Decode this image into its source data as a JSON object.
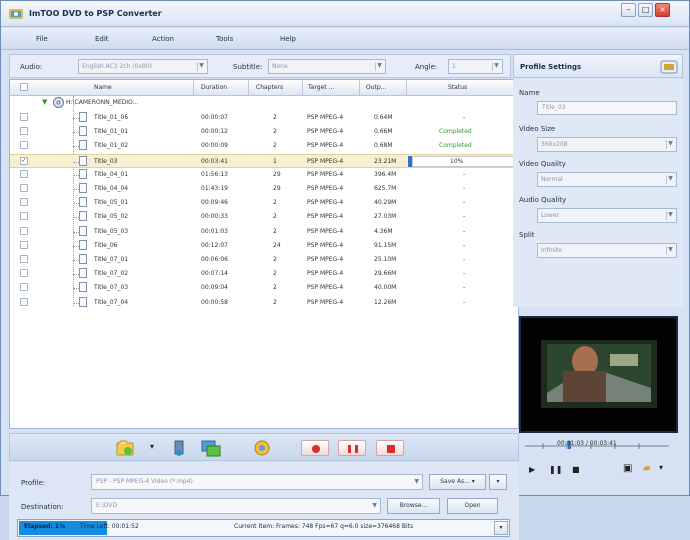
{
  "title": "ImTOO DVD to PSP Converter",
  "menu": [
    "File",
    "Edit",
    "Action",
    "Tools",
    "Help"
  ],
  "toolbar_top": {
    "audio_label": "Audio:",
    "audio_value": "English AC3 2ch (0x80)",
    "subtitle_label": "Subtitle:",
    "subtitle_value": "None",
    "angle_label": "Angle:",
    "angle_value": "1"
  },
  "columns": [
    "Name",
    "Duration",
    "Chapters",
    "Target ...",
    "Outp...",
    "Status"
  ],
  "root": {
    "name": "H:\\CAMERONN_MEDIO..."
  },
  "rows": [
    {
      "name": "Title_01_06",
      "duration": "00:00:07",
      "chapters": "2",
      "target": "PSP MPEG-4",
      "output": "0.64M",
      "status": "-"
    },
    {
      "name": "Title_01_01",
      "duration": "00:00:12",
      "chapters": "2",
      "target": "PSP MPEG-4",
      "output": "0.66M",
      "status": "Completed"
    },
    {
      "name": "Title_01_02",
      "duration": "00:00:09",
      "chapters": "2",
      "target": "PSP MPEG-4",
      "output": "0.68M",
      "status": "Completed"
    },
    {
      "name": "Title_03",
      "duration": "00:03:41",
      "chapters": "1",
      "target": "PSP MPEG-4",
      "output": "23.21M",
      "status": "10%"
    },
    {
      "name": "Title_04_01",
      "duration": "01:56:13",
      "chapters": "29",
      "target": "PSP MPEG-4",
      "output": "396.4M",
      "status": "-"
    },
    {
      "name": "Title_04_04",
      "duration": "01:43:19",
      "chapters": "29",
      "target": "PSP MPEG-4",
      "output": "625.7M",
      "status": "-"
    },
    {
      "name": "Title_05_01",
      "duration": "00:09:46",
      "chapters": "2",
      "target": "PSP MPEG-4",
      "output": "40.29M",
      "status": "-"
    },
    {
      "name": "Title_05_02",
      "duration": "00:00:33",
      "chapters": "2",
      "target": "PSP MPEG-4",
      "output": "27.03M",
      "status": "-"
    },
    {
      "name": "Title_05_03",
      "duration": "00:01:03",
      "chapters": "2",
      "target": "PSP MPEG-4",
      "output": "4.36M",
      "status": "-"
    },
    {
      "name": "Title_06",
      "duration": "00:12:07",
      "chapters": "24",
      "target": "PSP MPEG-4",
      "output": "91.15M",
      "status": "-"
    },
    {
      "name": "Title_07_01",
      "duration": "00:06:06",
      "chapters": "2",
      "target": "PSP MPEG-4",
      "output": "25.10M",
      "status": "-"
    },
    {
      "name": "Title_07_02",
      "duration": "00:07:14",
      "chapters": "2",
      "target": "PSP MPEG-4",
      "output": "29.66M",
      "status": "-"
    },
    {
      "name": "Title_07_03",
      "duration": "00:09:04",
      "chapters": "2",
      "target": "PSP MPEG-4",
      "output": "40.00M",
      "status": "-"
    },
    {
      "name": "Title_07_04",
      "duration": "00:00:58",
      "chapters": "2",
      "target": "PSP MPEG-4",
      "output": "12.26M",
      "status": "-"
    }
  ],
  "progress": {
    "row_index": 3,
    "value": 0.1,
    "label": "10%"
  },
  "bottom": {
    "profile_label": "Profile:",
    "profile_value": "PSP - PSP MPEG-4 Video (*.mp4)",
    "save_as": "Save As...",
    "destination_label": "Destination:",
    "destination_value": "E:\\DVD",
    "browse": "Browse...",
    "open": "Open"
  },
  "status": {
    "main": "Elapsed: 1%",
    "time_left": "Time Left: 00:01:52",
    "current_item": "Current Item: Frames: 748 Fps=67 q=6.0 size=376468 Bits"
  },
  "profile_settings": {
    "title": "Profile Settings",
    "name_label": "Name",
    "name_value": "Title_03",
    "video_size_label": "Video Size",
    "video_size_value": "368x208",
    "video_quality_label": "Video Quality",
    "video_quality_value": "Normal",
    "audio_quality_label": "Audio Quality",
    "audio_quality_value": "Lower",
    "split_label": "Split",
    "split_value": "Infinite"
  },
  "preview": {
    "timecode": "00:01:03 / 00:03:41"
  },
  "colors": {
    "accent": "#148de0",
    "completed": "#2f9d2f"
  }
}
